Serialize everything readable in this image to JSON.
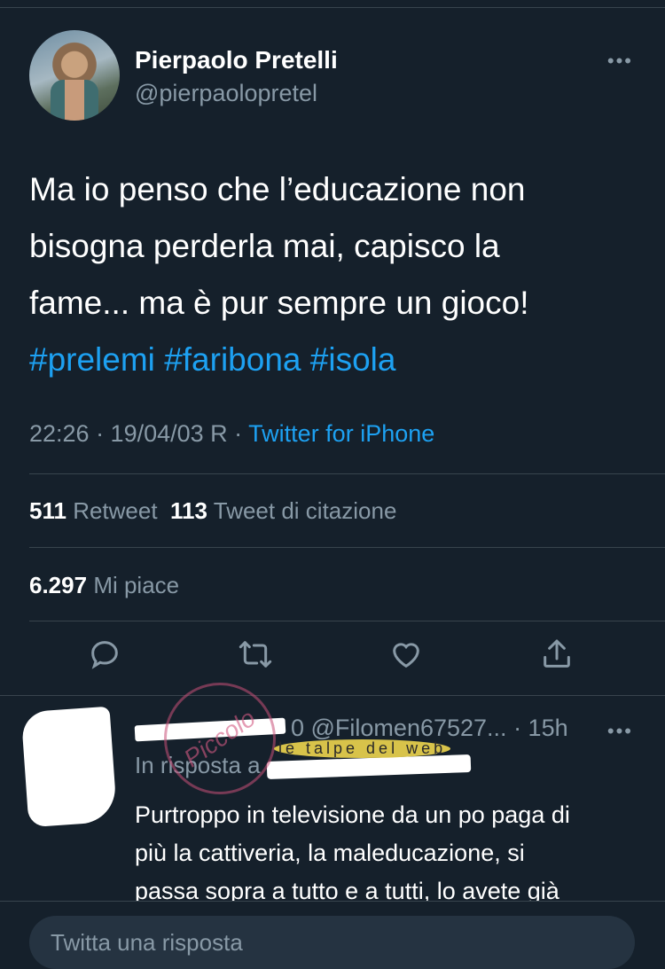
{
  "tweet": {
    "author_name": "Pierpaolo Pretelli",
    "author_handle": "@pierpaolopretel",
    "more_label": "•••",
    "text_lines": [
      "Ma io penso che l’educazione non",
      "bisogna perderla mai, capisco la",
      "fame... ma è pur sempre un gioco!"
    ],
    "hashtags": [
      "#prelemi",
      "#faribona",
      "#isola"
    ],
    "timestamp": "22:26 · 19/04/03 R ·",
    "source": "Twitter for iPhone",
    "stats": {
      "retweets_count": "511",
      "retweets_label": "Retweet",
      "quotes_count": "113",
      "quotes_label": "Tweet di citazione",
      "likes_count": "6.297",
      "likes_label": "Mi piace"
    },
    "actions": [
      "reply-icon",
      "retweet-icon",
      "like-icon",
      "share-icon"
    ]
  },
  "reply": {
    "name_partial": "0 @Filomen67527...",
    "time": "· 15h",
    "more_label": "•••",
    "in_reply_to": "In risposta a",
    "text_lines": [
      "Purtroppo in televisione da un po paga di",
      "più la cattiveria, la maleducazione, si",
      "passa sopra a tutto e a tutti, lo avete già"
    ]
  },
  "watermark": {
    "script_text": "Piccolo",
    "site_text": "le talpe del web"
  },
  "compose": {
    "placeholder": "Twitta una risposta"
  },
  "colors": {
    "background": "#15202b",
    "accent": "#1da1f2",
    "muted": "#8899a6",
    "divider": "#38444d"
  }
}
